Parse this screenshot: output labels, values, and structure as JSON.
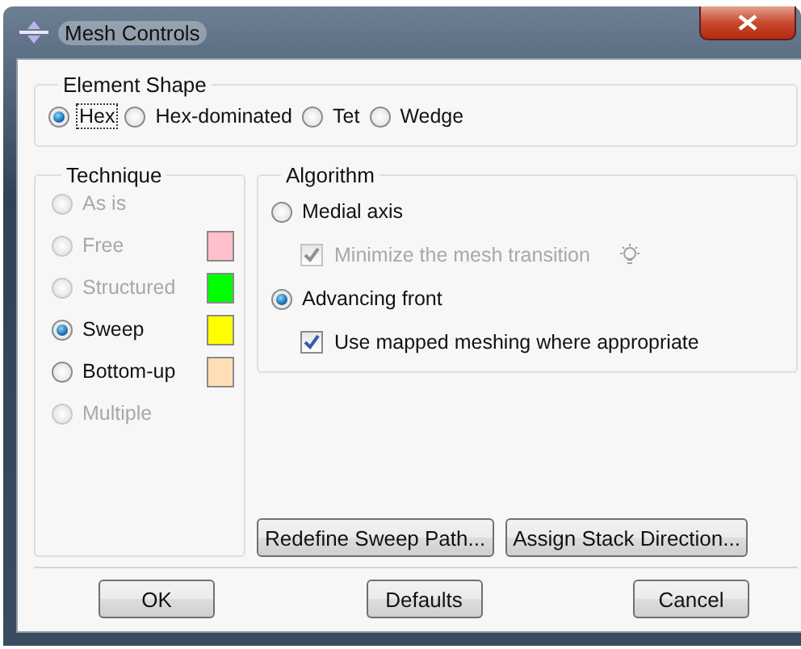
{
  "window": {
    "title": "Mesh Controls"
  },
  "element_shape": {
    "label": "Element Shape",
    "options": [
      {
        "label": "Hex",
        "selected": true,
        "focused": true
      },
      {
        "label": "Hex-dominated",
        "selected": false,
        "focused": false
      },
      {
        "label": "Tet",
        "selected": false,
        "focused": false
      },
      {
        "label": "Wedge",
        "selected": false,
        "focused": false
      }
    ]
  },
  "technique": {
    "label": "Technique",
    "options": [
      {
        "label": "As is",
        "selected": false,
        "disabled": true
      },
      {
        "label": "Free",
        "selected": false,
        "disabled": true,
        "color": "#ffc0cb"
      },
      {
        "label": "Structured",
        "selected": false,
        "disabled": true,
        "color": "#00ff00"
      },
      {
        "label": "Sweep",
        "selected": true,
        "disabled": false,
        "color": "#ffff00"
      },
      {
        "label": "Bottom-up",
        "selected": false,
        "disabled": false,
        "color": "#ffdeb7"
      },
      {
        "label": "Multiple",
        "selected": false,
        "disabled": true
      }
    ]
  },
  "algorithm": {
    "label": "Algorithm",
    "options": [
      {
        "label": "Medial axis",
        "selected": false,
        "option": {
          "label": "Minimize the mesh transition",
          "checked": true,
          "disabled": true,
          "hint": true
        }
      },
      {
        "label": "Advancing front",
        "selected": true,
        "option": {
          "label": "Use mapped meshing where appropriate",
          "checked": true,
          "disabled": false,
          "hint": false
        }
      }
    ]
  },
  "side_buttons": [
    "Redefine Sweep Path...",
    "Assign Stack Direction..."
  ],
  "buttons": [
    "OK",
    "Defaults",
    "Cancel"
  ]
}
